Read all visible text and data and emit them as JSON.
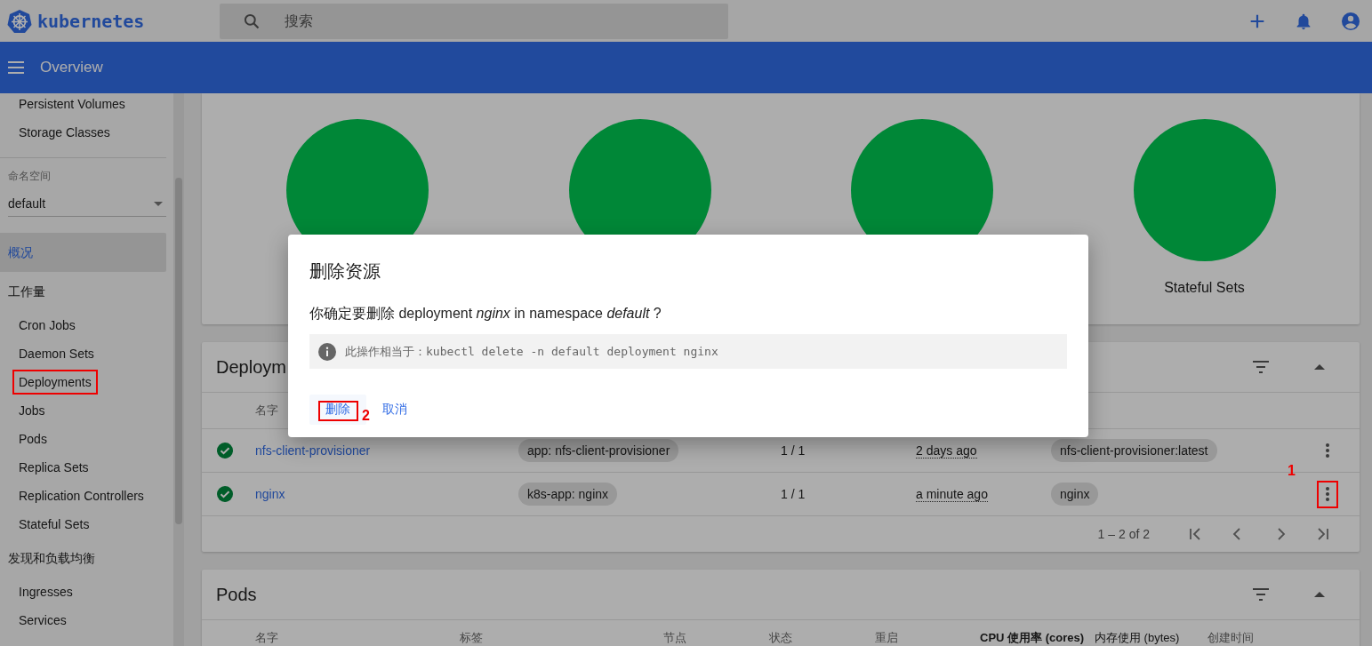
{
  "top_bar": {
    "brand": "kubernetes",
    "search": {
      "placeholder": "搜索"
    }
  },
  "title_bar": {
    "title": "Overview"
  },
  "sidebar": {
    "groups": [
      {
        "items": [
          {
            "label": "Persistent Volumes",
            "selected": false,
            "marked": false
          },
          {
            "label": "Storage Classes",
            "selected": false,
            "marked": false
          }
        ]
      },
      {
        "kind": "namespace",
        "label": "命名空间",
        "value": "default"
      },
      {
        "heading": "概况",
        "selected": true
      },
      {
        "heading": "工作量",
        "selected": false,
        "items": [
          {
            "label": "Cron Jobs",
            "selected": false,
            "marked": false
          },
          {
            "label": "Daemon Sets",
            "selected": false,
            "marked": false
          },
          {
            "label": "Deployments",
            "selected": false,
            "marked": true
          },
          {
            "label": "Jobs",
            "selected": false,
            "marked": false
          },
          {
            "label": "Pods",
            "selected": false,
            "marked": false
          },
          {
            "label": "Replica Sets",
            "selected": false,
            "marked": false
          },
          {
            "label": "Replication Controllers",
            "selected": false,
            "marked": false
          },
          {
            "label": "Stateful Sets",
            "selected": false,
            "marked": false
          }
        ]
      },
      {
        "heading": "发现和负载均衡",
        "selected": false,
        "items": [
          {
            "label": "Ingresses",
            "selected": false,
            "marked": false
          },
          {
            "label": "Services",
            "selected": false,
            "marked": false
          }
        ]
      }
    ]
  },
  "status_card": {
    "charts": [
      {
        "kind": "pie"
      },
      {
        "kind": "pie"
      },
      {
        "kind": "pie"
      },
      {
        "kind": "pie",
        "label": "Stateful Sets"
      }
    ]
  },
  "deployments": {
    "title": "Deploym",
    "columns": [
      "名字"
    ],
    "rows": [
      {
        "name": "nfs-client-provisioner",
        "label": "app: nfs-client-provisioner",
        "pods": "1 / 1",
        "age": "2 days ago",
        "image": "nfs-client-provisioner:latest"
      },
      {
        "name": "nginx",
        "label": "k8s-app: nginx",
        "pods": "1 / 1",
        "age": "a minute ago",
        "image": "nginx",
        "marker": "1"
      }
    ],
    "pagination": "1 – 2 of 2"
  },
  "pods": {
    "title": "Pods",
    "columns": [
      "名字",
      "标签",
      "节点",
      "状态",
      "重启",
      "CPU 使用率 (cores)",
      "内存使用 (bytes)",
      "创建时间"
    ]
  },
  "dialog": {
    "title": "删除资源",
    "message": "你确定要删除 deployment *nginx*  in namespace *default* ?",
    "info": "此操作相当于：",
    "command": "kubectl delete -n default deployment nginx",
    "buttons": [
      {
        "label": "删除",
        "marker": "2"
      },
      {
        "label": "取消"
      }
    ]
  }
}
